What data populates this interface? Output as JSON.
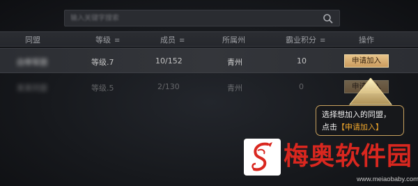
{
  "search": {
    "placeholder": "输入关键字搜索"
  },
  "table": {
    "headers": {
      "alliance": "同盟",
      "level": "等级",
      "members": "成员",
      "state": "所属州",
      "score": "霸业积分",
      "action": "操作"
    },
    "sort_icon": "≡",
    "rows": [
      {
        "name": "白帝军团",
        "level": "等级.7",
        "members": "10/152",
        "state": "青州",
        "score": "10",
        "action": "申请加入"
      },
      {
        "name": "某某同盟",
        "level": "等级.5",
        "members": "2/130",
        "state": "青州",
        "score": "0",
        "action": "申请加入"
      }
    ]
  },
  "callout": {
    "line1": "选择想加入的同盟，",
    "line2_prefix": "点击",
    "line2_highlight": "【申请加入】"
  },
  "watermark": {
    "brand": "梅奥软件园",
    "url": "www.meiaobaby.com"
  },
  "colors": {
    "button": "#d4a86a",
    "callout_border": "#c9a25e",
    "callout_highlight": "#f0a72c",
    "watermark_red": "#d9271f"
  }
}
